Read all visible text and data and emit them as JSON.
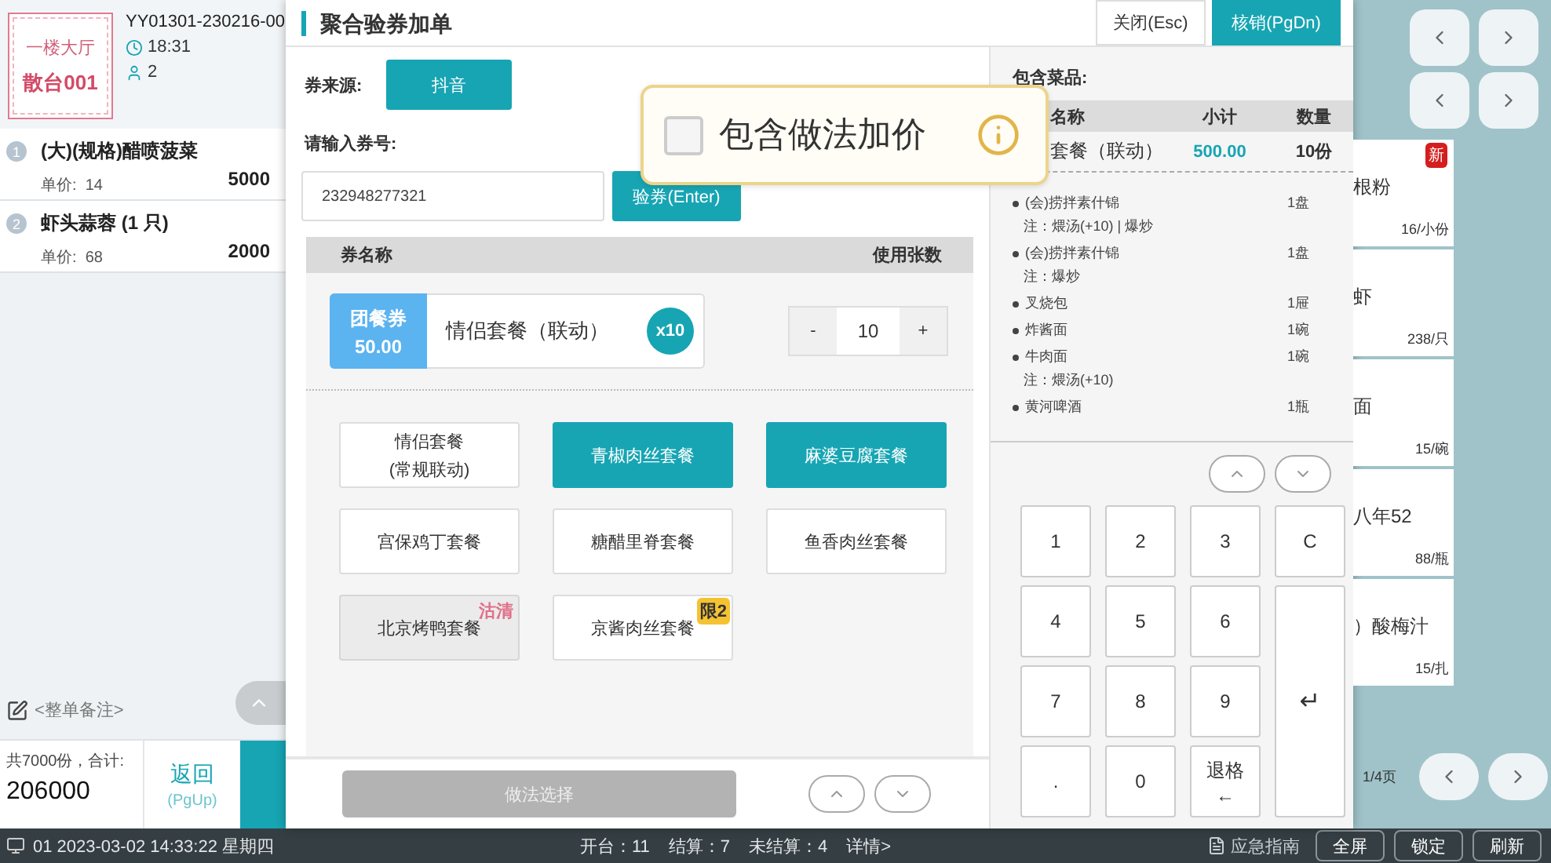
{
  "order_panel": {
    "area": "一楼大厅",
    "table": "散台001",
    "order_no": "YY01301-230216-00",
    "time": "18:31",
    "guests": "2",
    "items": [
      {
        "index": "1",
        "name": "(大)(规格)醋喷菠菜",
        "price_label": "单价:",
        "price": "14",
        "qty": "5000"
      },
      {
        "index": "2",
        "name": "虾头蒜蓉 (1 只)",
        "price_label": "单价:",
        "price": "68",
        "qty": "2000"
      }
    ],
    "remark_placeholder": "<整单备注>",
    "total_label": "共7000份，合计:",
    "total": "206000",
    "back_label": "返回",
    "back_shortcut": "(PgUp)"
  },
  "dialog": {
    "title": "聚合验券加单",
    "buttons": [
      {
        "label": "关闭(Esc)",
        "primary": false
      },
      {
        "label": "核销(PgDn)",
        "primary": true
      }
    ],
    "source_label": "券来源:",
    "source": "抖音",
    "code_label": "请输入券号:",
    "code_value": "232948277321",
    "verify_button": "验券(Enter)",
    "coupon_columns": [
      "券名称",
      "使用张数"
    ],
    "coupon": {
      "type": "团餐券",
      "amount": "50.00",
      "name": "情侣套餐（联动）",
      "badge": "x10",
      "minus": "-",
      "count": "10",
      "plus": "+"
    },
    "packages": [
      {
        "kind": "plain",
        "lines": [
          "情侣套餐",
          "(常规联动)"
        ],
        "selected": false,
        "disabled": false
      },
      {
        "kind": "plain",
        "lines": [
          "青椒肉丝套餐"
        ],
        "selected": true,
        "disabled": false
      },
      {
        "kind": "plain",
        "lines": [
          "麻婆豆腐套餐"
        ],
        "selected": true,
        "disabled": false
      },
      {
        "kind": "plain",
        "lines": [
          "宫保鸡丁套餐"
        ],
        "selected": false,
        "disabled": false
      },
      {
        "kind": "plain",
        "lines": [
          "糖醋里脊套餐"
        ],
        "selected": false,
        "disabled": false
      },
      {
        "kind": "plain",
        "lines": [
          "鱼香肉丝套餐"
        ],
        "selected": false,
        "disabled": false
      },
      {
        "kind": "soldout",
        "lines": [
          "北京烤鸭套餐"
        ],
        "selected": false,
        "disabled": true,
        "tag": "沽清"
      },
      {
        "kind": "limit",
        "lines": [
          "京酱肉丝套餐"
        ],
        "selected": false,
        "disabled": false,
        "tag": "限2"
      }
    ],
    "method_button": {
      "label": "做法选择",
      "disabled": true
    },
    "dishes_title": "包含菜品:",
    "dish_columns": [
      "名称",
      "小计",
      "数量"
    ],
    "set_row": {
      "name": "套餐（联动）",
      "subtotal": "500.00",
      "qty": "10份"
    },
    "dishes": [
      {
        "name": "(会)捞拌素什锦",
        "qty": "1盘",
        "note": "注：煨汤(+10) | 爆炒"
      },
      {
        "name": "(会)捞拌素什锦",
        "qty": "1盘",
        "note": "注：爆炒"
      },
      {
        "name": "叉烧包",
        "qty": "1屉"
      },
      {
        "name": "炸酱面",
        "qty": "1碗"
      },
      {
        "name": "牛肉面",
        "qty": "1碗",
        "note": "注：煨汤(+10)"
      },
      {
        "name": "黄河啤酒",
        "qty": "1瓶"
      }
    ],
    "keypad": [
      {
        "label": "1",
        "kind": "key"
      },
      {
        "label": "2",
        "kind": "key"
      },
      {
        "label": "3",
        "kind": "key"
      },
      {
        "label": "C",
        "kind": "key"
      },
      {
        "label": "4",
        "kind": "key"
      },
      {
        "label": "5",
        "kind": "key"
      },
      {
        "label": "6",
        "kind": "key"
      },
      {
        "label": "7",
        "kind": "key"
      },
      {
        "label": "8",
        "kind": "key"
      },
      {
        "label": "9",
        "kind": "key"
      },
      {
        "label": "↵",
        "kind": "enter"
      },
      {
        "label": ".",
        "kind": "key"
      },
      {
        "label": "0",
        "kind": "key"
      },
      {
        "label": "退格",
        "kind": "backspace",
        "sub": "←"
      }
    ],
    "popup": {
      "label": "包含做法加价",
      "checked": false
    }
  },
  "menu_panel": {
    "cards": [
      {
        "name": "根粉",
        "price": "16/小份",
        "badge": "新"
      },
      {
        "name": "虾",
        "price": "238/只"
      },
      {
        "name": "面",
        "price": "15/碗"
      },
      {
        "name": "八年52",
        "price": "88/瓶"
      },
      {
        "name": "）酸梅汁",
        "price": "15/扎"
      }
    ],
    "page": "1/4页"
  },
  "status_bar": {
    "terminal": "01 2023-03-02 14:33:22 星期四",
    "stats": [
      "开台：11",
      "结算：7",
      "未结算：4",
      "详情>"
    ],
    "guide": "应急指南",
    "buttons": [
      "全屏",
      "锁定",
      "刷新"
    ]
  }
}
